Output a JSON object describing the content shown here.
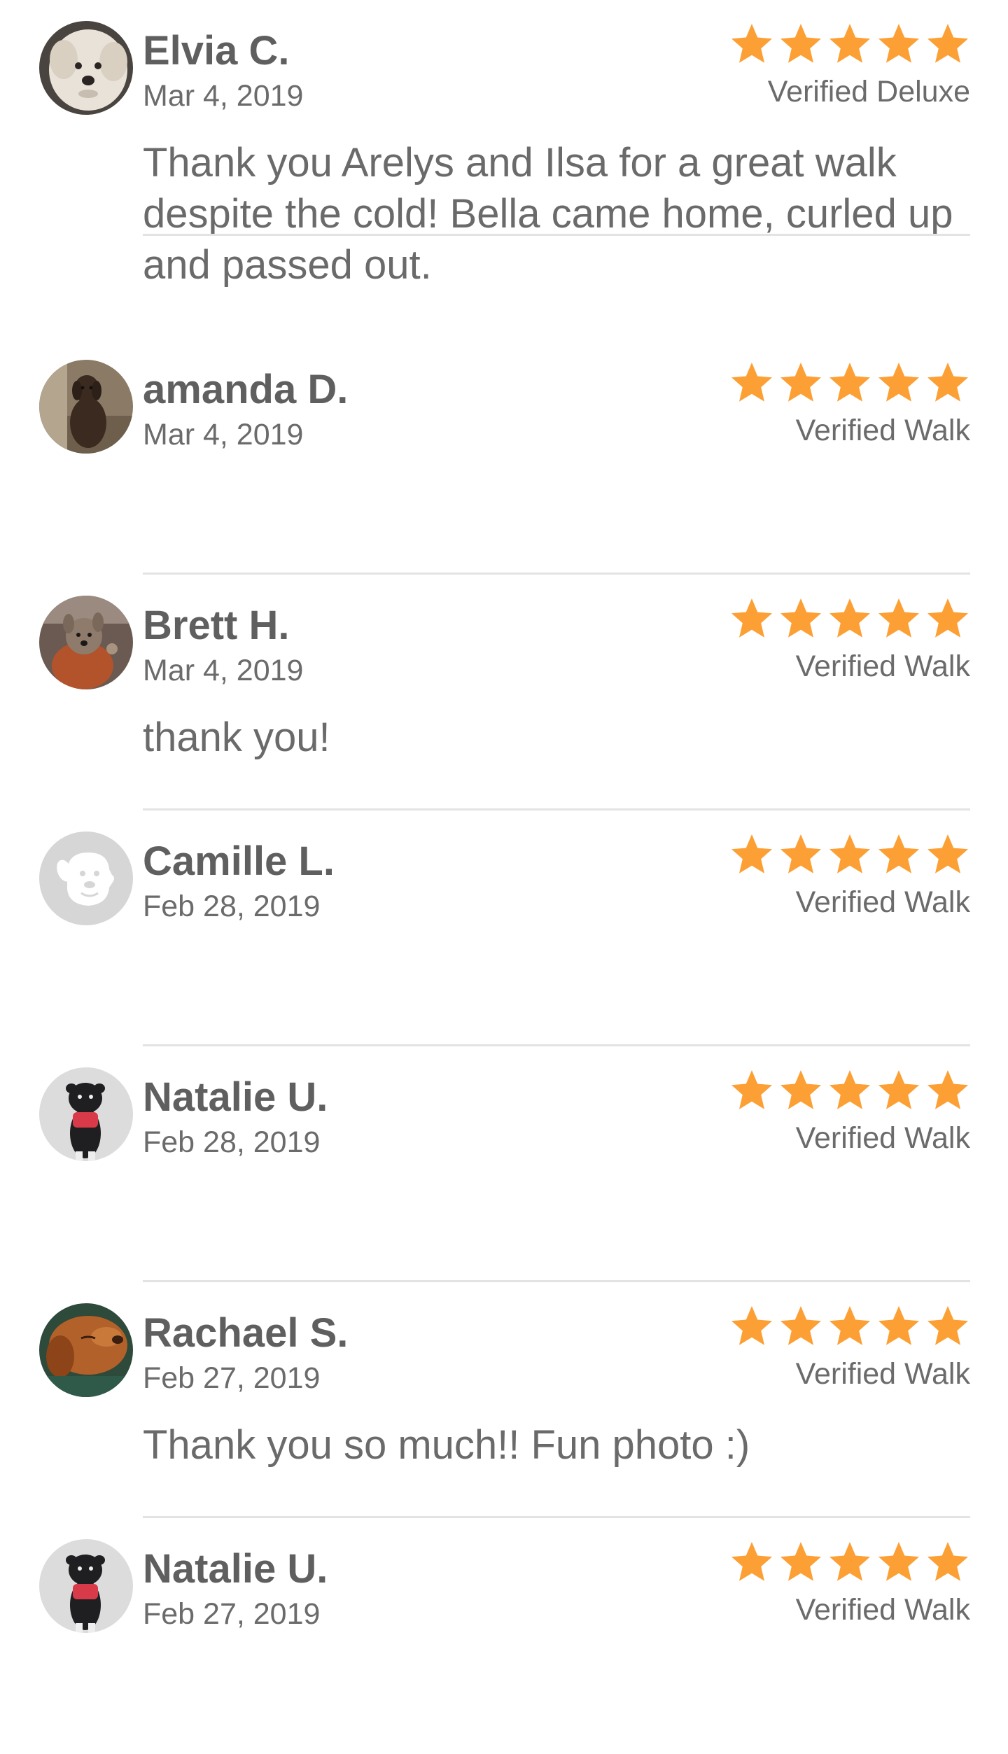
{
  "colors": {
    "star": "#fca035",
    "text": "#666666",
    "divider": "#e3e3e3"
  },
  "reviews": [
    {
      "name": "Elvia C.",
      "date": "Mar 4, 2019",
      "rating": 5,
      "verified": "Verified Deluxe",
      "text": "Thank you Arelys and Ilsa for a great walk despite the cold! Bella came home, curled up and passed out.",
      "avatar": "poodle-photo"
    },
    {
      "name": "amanda D.",
      "date": "Mar 4, 2019",
      "rating": 5,
      "verified": "Verified Walk",
      "text": "",
      "avatar": "chocolate-lab-photo"
    },
    {
      "name": "Brett H.",
      "date": "Mar 4, 2019",
      "rating": 5,
      "verified": "Verified Walk",
      "text": "thank you!",
      "avatar": "terrier-sweater-photo"
    },
    {
      "name": "Camille L.",
      "date": "Feb 28, 2019",
      "rating": 5,
      "verified": "Verified Walk",
      "text": "",
      "avatar": "default-dog-icon"
    },
    {
      "name": "Natalie U.",
      "date": "Feb 28, 2019",
      "rating": 5,
      "verified": "Verified Walk",
      "text": "",
      "avatar": "pug-photo"
    },
    {
      "name": "Rachael S.",
      "date": "Feb 27, 2019",
      "rating": 5,
      "verified": "Verified Walk",
      "text": "Thank you so much!! Fun photo :)",
      "avatar": "brown-dog-photo"
    },
    {
      "name": "Natalie U.",
      "date": "Feb 27, 2019",
      "rating": 5,
      "verified": "Verified Walk",
      "text": "",
      "avatar": "pug-photo"
    }
  ]
}
